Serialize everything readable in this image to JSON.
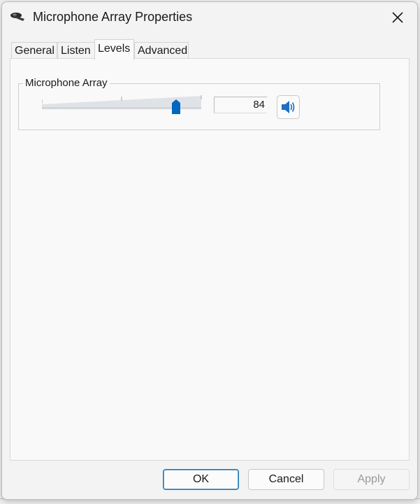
{
  "window": {
    "title": "Microphone Array Properties"
  },
  "tabs": [
    {
      "label": "General"
    },
    {
      "label": "Listen"
    },
    {
      "label": "Levels"
    },
    {
      "label": "Advanced"
    }
  ],
  "levels": {
    "group_label": "Microphone Array",
    "level_value": "84",
    "level_fraction": 0.84
  },
  "buttons": {
    "ok": "OK",
    "cancel": "Cancel",
    "apply": "Apply"
  },
  "icons": {
    "app": "microphone-icon",
    "close": "close-icon",
    "speaker": "speaker-icon"
  },
  "colors": {
    "accent": "#0067c0",
    "panel": "#f9f9f9"
  }
}
